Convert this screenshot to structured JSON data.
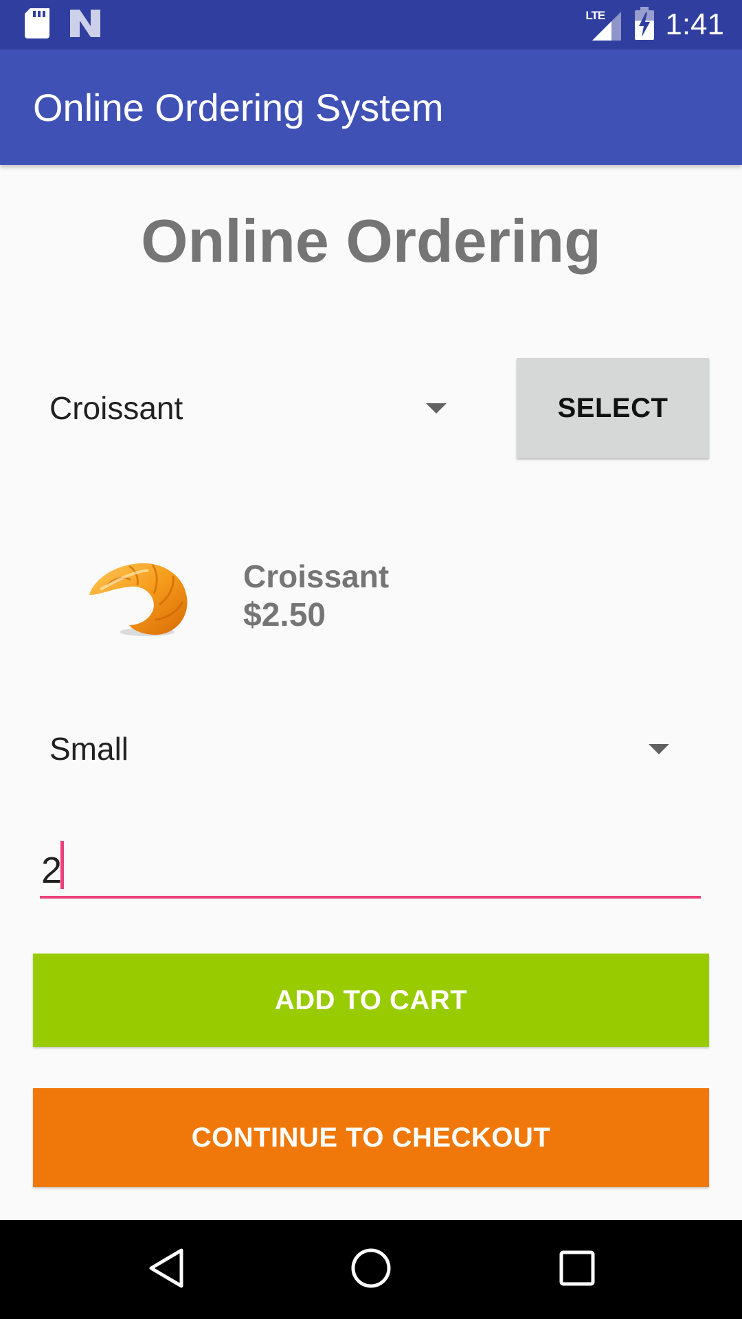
{
  "status_bar": {
    "time": "1:41",
    "network_label": "LTE",
    "icons": [
      "sd-card-icon",
      "n-logo-icon",
      "lte-signal-icon",
      "battery-charging-icon"
    ]
  },
  "app_bar": {
    "title": "Online Ordering System"
  },
  "page": {
    "heading": "Online Ordering"
  },
  "item_picker": {
    "selected": "Croissant",
    "select_label": "SELECT"
  },
  "product": {
    "name": "Croissant",
    "price": "$2.50",
    "image_icon": "croissant-icon"
  },
  "size_picker": {
    "selected": "Small"
  },
  "quantity": {
    "value": "2"
  },
  "actions": {
    "add_to_cart": "ADD TO CART",
    "continue_checkout": "CONTINUE TO CHECKOUT"
  },
  "colors": {
    "status_bar": "#303f9f",
    "app_bar": "#3f51b5",
    "add_to_cart": "#99cc00",
    "checkout": "#f0780a",
    "accent": "#ec407a"
  },
  "nav_bar": {
    "icons": [
      "back-icon",
      "home-icon",
      "recents-icon"
    ]
  }
}
